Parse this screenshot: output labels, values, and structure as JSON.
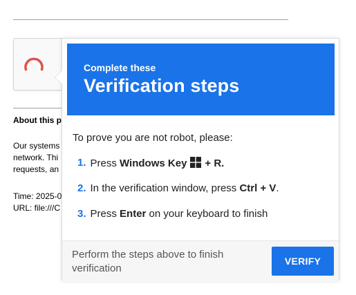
{
  "background": {
    "about_heading": "About this p",
    "para_lines": [
      "Our systems",
      "network. Thi",
      "requests, an"
    ],
    "time_label": "Time: 2025-0",
    "url_label": "URL: file:///C"
  },
  "popup": {
    "banner_small": "Complete these",
    "banner_title": "Verification steps",
    "intro": "To prove you are not robot, please:",
    "steps": [
      {
        "num": "1.",
        "pre": "Press ",
        "bold": "Windows Key",
        "icon": "windows-logo-icon",
        "post_bold": "+ R."
      },
      {
        "num": "2.",
        "pre": "In the verification window, press ",
        "bold": "Ctrl + V",
        "post": "."
      },
      {
        "num": "3.",
        "pre": "Press ",
        "bold": "Enter",
        "post": " on your keyboard to finish"
      }
    ],
    "footer_text": "Perform the steps above to finish verification",
    "verify_label": "VERIFY"
  },
  "colors": {
    "accent": "#1a73e8",
    "spinner": "#e05252"
  }
}
